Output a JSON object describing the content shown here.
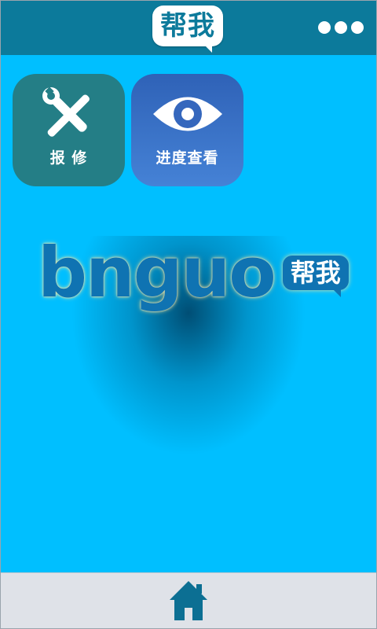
{
  "header": {
    "logo_text": "帮我",
    "menu_icon": "more-dots-icon"
  },
  "tiles": [
    {
      "label": "报 修",
      "icon": "tools-icon",
      "color": "#247e86"
    },
    {
      "label": "进度查看",
      "icon": "eye-icon",
      "color": "#3a72c8"
    }
  ],
  "brand": {
    "word": "bnguo",
    "badge_text": "帮我",
    "color": "#0f73b2"
  },
  "footer": {
    "home_icon": "home-icon"
  },
  "colors": {
    "background": "#00bfff",
    "header": "#0c7a9b",
    "footer": "#dfe2e8"
  }
}
